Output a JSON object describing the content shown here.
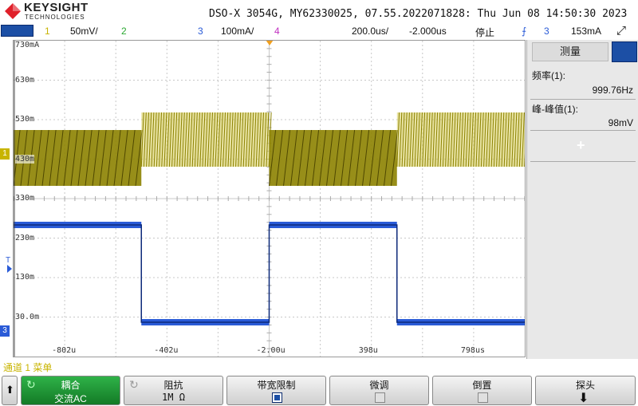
{
  "brand": {
    "name": "KEYSIGHT",
    "sub": "TECHNOLOGIES"
  },
  "title": "DSO-X 3054G, MY62330025, 07.55.2022071828: Thu Jun 08 14:50:30 2023",
  "channels": {
    "ch1_num": "1",
    "ch1_scale": "50mV/",
    "ch2_num": "2",
    "ch3_num": "3",
    "ch3_scale": "100mA/",
    "ch4_num": "4",
    "timebase": "200.0us/",
    "delay": "-2.000us",
    "run_state": "停止",
    "trig_source": "3",
    "trig_level": "153mA"
  },
  "y_labels": [
    "730mA",
    "630m",
    "530m",
    "430m",
    "330m",
    "230m",
    "130m",
    "30.0m"
  ],
  "x_labels": [
    "-802u",
    "-402u",
    "-2.00u",
    "398u",
    "798us"
  ],
  "markers": {
    "ch1": "1",
    "ch3": "3",
    "trigger": "T"
  },
  "measure": {
    "header": "测量",
    "freq_label": "频率(1):",
    "freq_value": "999.76Hz",
    "vpp_label": "峰-峰值(1):",
    "vpp_value": "98mV",
    "add_symbol": "+"
  },
  "statusline": "通道 1 菜单",
  "softkeys": {
    "coupling": {
      "label": "耦合",
      "value": "交流AC"
    },
    "impedance": {
      "label": "阻抗",
      "value": "1M Ω"
    },
    "bwlimit": {
      "label": "带宽限制"
    },
    "fine": {
      "label": "微调"
    },
    "invert": {
      "label": "倒置"
    },
    "probe": {
      "label": "探头"
    }
  },
  "colors": {
    "ch1": "#8c8200",
    "ch1_light": "#d6cc55",
    "ch3": "#2a5bd7",
    "grid": "#bbbbbb",
    "softkey_active": "#1a8a2e"
  }
}
